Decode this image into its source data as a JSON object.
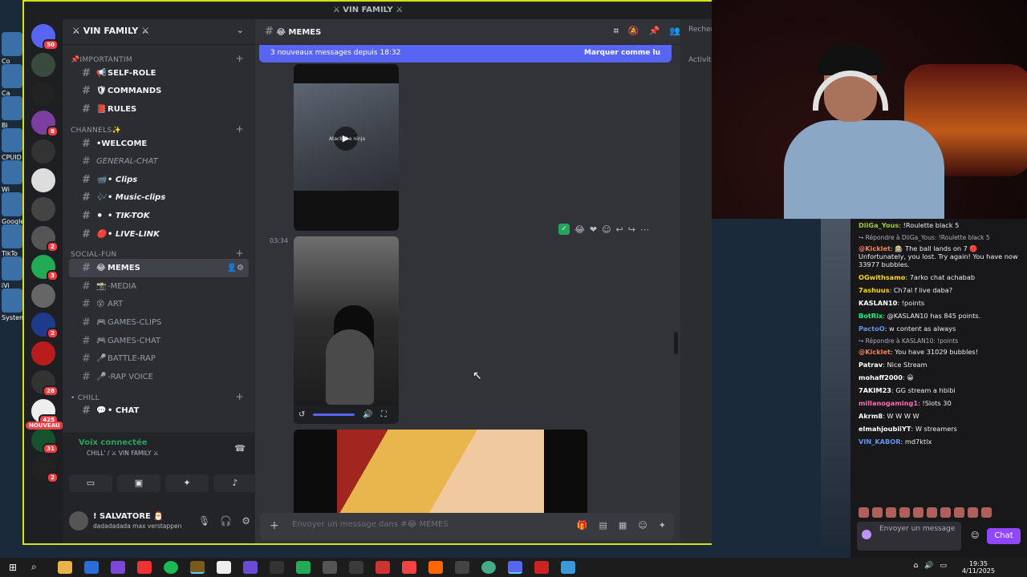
{
  "desktop": {
    "icons": [
      "Co",
      "Ca",
      "Bi",
      "CPUID",
      "Wi",
      "Google",
      "TikTo",
      "iVi",
      "Systeme"
    ]
  },
  "discord": {
    "title": "⚔ VIN FAMILY ⚔",
    "guild_name": "⚔ VIN FAMILY ⚔",
    "server_badges": [
      "50",
      "8",
      "2",
      "3",
      "2",
      "28",
      "425",
      "31",
      "2"
    ],
    "new_label": "NOUVEAU",
    "categories": [
      {
        "label": "📌IMPORTANTIM",
        "channels": [
          {
            "emoji": "📢",
            "name": "SELF-ROLE"
          },
          {
            "emoji": "🛡",
            "name": "COMMANDS"
          },
          {
            "emoji": "📕",
            "name": "RULES"
          }
        ]
      },
      {
        "label": "CHANNELS✨",
        "channels": [
          {
            "emoji": "",
            "name": "•WELCOME"
          },
          {
            "emoji": "",
            "name": "GENERAL-CHAT"
          },
          {
            "emoji": "📹",
            "name": "• Clips"
          },
          {
            "emoji": "🎶",
            "name": "• Music-clips"
          },
          {
            "emoji": "⚫",
            "name": "• TIK-TOK"
          },
          {
            "emoji": "🔴",
            "name": "• LIVE-LINK"
          }
        ]
      },
      {
        "label": "SOCIAL-FUN",
        "channels": [
          {
            "emoji": "😂",
            "name": "MEMES"
          },
          {
            "emoji": "📸",
            "name": "-MEDIA"
          },
          {
            "emoji": "😵",
            "name": "ART"
          },
          {
            "emoji": "🎮",
            "name": "GAMES-CLIPS"
          },
          {
            "emoji": "🎮",
            "name": "GAMES-CHAT"
          },
          {
            "emoji": "🎤",
            "name": "BATTLE-RAP"
          },
          {
            "emoji": "🎤",
            "name": "-RAP VOICE"
          }
        ]
      },
      {
        "label": "• CHILL",
        "channels": [
          {
            "emoji": "💬",
            "name": "• CHAT"
          }
        ]
      }
    ],
    "voice": {
      "title": "Voix connectée",
      "subtitle": "CHILL' / ⚔ VIN FAMILY ⚔"
    },
    "user": {
      "name": "! SALVATORE 🎅",
      "status": "dadadadada max verstappen"
    },
    "channel_header": "😂 MEMES",
    "new_messages_bar": "3 nouveaux messages depuis 18:32",
    "mark_read": "Marquer comme lu",
    "timestamp": "03:34",
    "video_label": "Atack the ninja",
    "composer_placeholder": "Envoyer un message dans #😂 MEMES",
    "search_placeholder": "Recher",
    "members_activity": "Activité"
  },
  "stream_chat": {
    "messages": [
      {
        "type": "msg",
        "name": "DiiGa_Yous",
        "color": "#9acd32",
        "text": ": !Roulette black 5"
      },
      {
        "type": "reply",
        "text": "Répondre à DiiGa_Yous: !Roulette black 5"
      },
      {
        "type": "msg",
        "name": "@Kicklet",
        "color": "#ff7f50",
        "text": ": 🎰 The ball lands on 7 🔴 Unfortunately, you lost. Try again! You have now 33977 bubbles."
      },
      {
        "type": "msg",
        "name": "OGwithsamo",
        "color": "#ffd700",
        "text": ": 7arko chat achabab"
      },
      {
        "type": "msg",
        "name": "7ashuus",
        "color": "#ffd700",
        "text": ": Ch7al f live daba?"
      },
      {
        "type": "msg",
        "name": "KASLAN10",
        "color": "#ffffff",
        "text": ": !points"
      },
      {
        "type": "msg",
        "name": "BotRix",
        "color": "#00ff7f",
        "text": ": @KASLAN10 has 845 points."
      },
      {
        "type": "msg",
        "name": "PactoO",
        "color": "#6495ed",
        "text": ": w content as always"
      },
      {
        "type": "reply",
        "text": "Répondre à KASLAN10: !points"
      },
      {
        "type": "msg",
        "name": "@Kicklet",
        "color": "#ff7f50",
        "text": ": You have 31029 bubbles!"
      },
      {
        "type": "msg",
        "name": "Patrav",
        "color": "#ffffff",
        "text": ": Nice Stream"
      },
      {
        "type": "msg",
        "name": "mohaff2000",
        "color": "#ffffff",
        "text": ": 😀"
      },
      {
        "type": "msg",
        "name": "7AKIM23",
        "color": "#ffffff",
        "text": ": GG stream a hbibi"
      },
      {
        "type": "msg",
        "name": "millanogaming1",
        "color": "#ff69b4",
        "text": ": !Slots 30"
      },
      {
        "type": "msg",
        "name": "Akrm8",
        "color": "#ffffff",
        "text": ": W W W W"
      },
      {
        "type": "msg",
        "name": "elmahjoubiiYT",
        "color": "#ffffff",
        "text": ": W streamers"
      },
      {
        "type": "msg",
        "name": "VIN_KABOR",
        "color": "#6495ed",
        "text": ": md7ktlx"
      }
    ],
    "input_placeholder": "Envoyer un message",
    "send_label": "Chat"
  },
  "taskbar": {
    "time": "19:35",
    "date": "4/11/2025"
  }
}
